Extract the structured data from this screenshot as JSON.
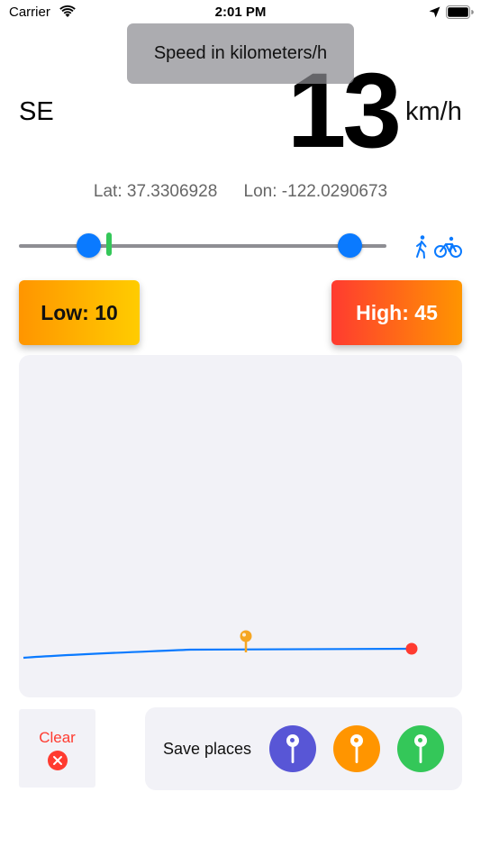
{
  "status_bar": {
    "carrier": "Carrier",
    "time": "2:01 PM",
    "icons": [
      "wifi-icon",
      "location-arrow-icon",
      "battery-icon"
    ]
  },
  "toast": {
    "text": "Speed in kilometers/h"
  },
  "speed": {
    "direction": "SE",
    "value": "13",
    "unit": "km/h"
  },
  "coordinates": {
    "lat": "Lat: 37.3306928",
    "lon": "Lon: -122.0290673"
  },
  "slider": {
    "low_fraction": 0.19,
    "current_fraction": 0.245,
    "high_fraction": 0.9,
    "mode_icons": [
      "walk-icon",
      "bike-icon"
    ]
  },
  "limits": {
    "low_label": "Low: 10",
    "high_label": "High: 45"
  },
  "map": {
    "route_color": "#0a7aff",
    "marker_color": "#ff3b30",
    "pin_color": "#f5a623"
  },
  "bottom": {
    "clear_label": "Clear",
    "save_label": "Save places",
    "pins": [
      {
        "name": "purple",
        "color": "#5856d6"
      },
      {
        "name": "orange",
        "color": "#ff9500"
      },
      {
        "name": "green",
        "color": "#34c759"
      }
    ]
  },
  "colors": {
    "accent": "#0a7aff",
    "low_gradient": [
      "#ff9500",
      "#ffcc00"
    ],
    "high_gradient": [
      "#ff3b30",
      "#ff9500"
    ],
    "clear_red": "#ff3b30"
  }
}
